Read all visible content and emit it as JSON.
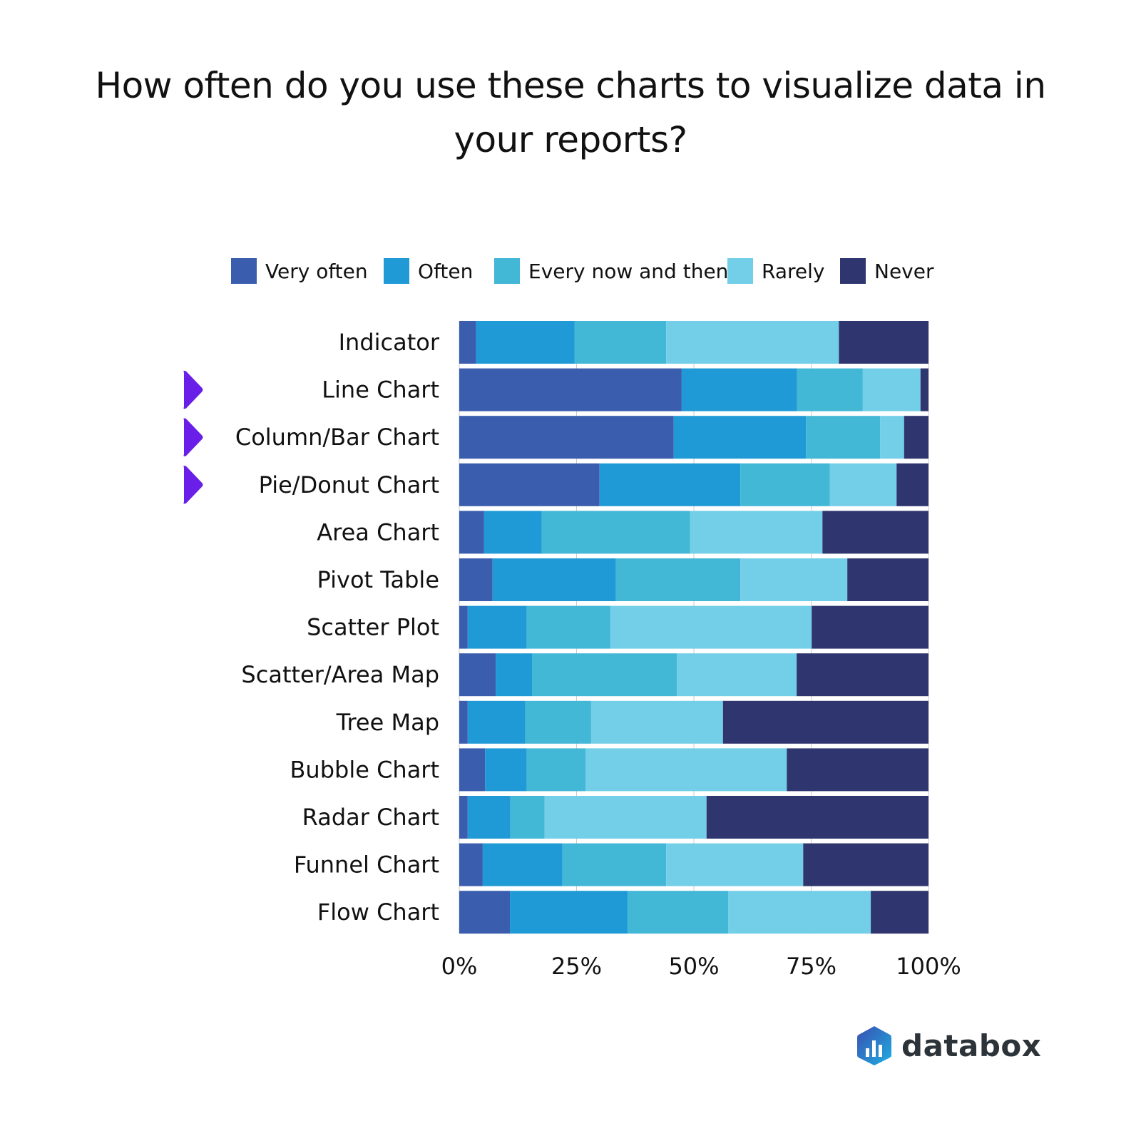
{
  "chart_data": {
    "type": "bar",
    "orientation": "horizontal",
    "stacked": "100%",
    "title": "How often do you use these charts to visualize data in your reports?",
    "title_lines": [
      "How often do you use these charts to visualize data in",
      "your reports?"
    ],
    "xlabel": "",
    "ylabel": "",
    "xlim": [
      0,
      100
    ],
    "x_ticks": [
      "0%",
      "25%",
      "50%",
      "75%",
      "100%"
    ],
    "x_tick_values": [
      0,
      25,
      50,
      75,
      100
    ],
    "grid": true,
    "legend_position": "top",
    "categories": [
      "Indicator",
      "Line Chart",
      "Column/Bar Chart",
      "Pie/Donut Chart",
      "Area Chart",
      "Pivot Table",
      "Scatter Plot",
      "Scatter/Area Map",
      "Tree Map",
      "Bubble Chart",
      "Radar Chart",
      "Funnel Chart",
      "Flow Chart"
    ],
    "highlighted_categories": [
      "Line Chart",
      "Column/Bar Chart",
      "Pie/Donut Chart"
    ],
    "series": [
      {
        "name": "Very often",
        "color": "#3a5dae",
        "values": [
          3.6,
          47.4,
          45.7,
          29.9,
          5.3,
          7.1,
          1.8,
          7.8,
          1.8,
          5.5,
          1.8,
          5.0,
          10.8
        ]
      },
      {
        "name": "Often",
        "color": "#1f9ad6",
        "values": [
          21.0,
          24.6,
          28.2,
          30.0,
          12.3,
          26.3,
          12.6,
          7.7,
          12.3,
          8.9,
          9.1,
          17.0,
          25.1
        ]
      },
      {
        "name": "Every now and then",
        "color": "#42b7d6",
        "values": [
          19.5,
          14.0,
          15.8,
          19.1,
          31.6,
          26.5,
          17.8,
          30.9,
          14.0,
          12.5,
          7.3,
          22.1,
          21.4
        ]
      },
      {
        "name": "Rarely",
        "color": "#72cfe7",
        "values": [
          36.8,
          12.3,
          5.1,
          14.2,
          28.2,
          22.8,
          42.9,
          25.5,
          28.1,
          42.9,
          34.5,
          29.2,
          30.4
        ]
      },
      {
        "name": "Never",
        "color": "#2f356e",
        "values": [
          19.1,
          1.7,
          5.2,
          6.8,
          22.6,
          17.3,
          24.9,
          28.1,
          43.8,
          30.2,
          47.3,
          26.7,
          12.3
        ]
      }
    ]
  },
  "branding": {
    "logo_text": "databox",
    "highlight_marker_color": "#6a1fe8"
  }
}
